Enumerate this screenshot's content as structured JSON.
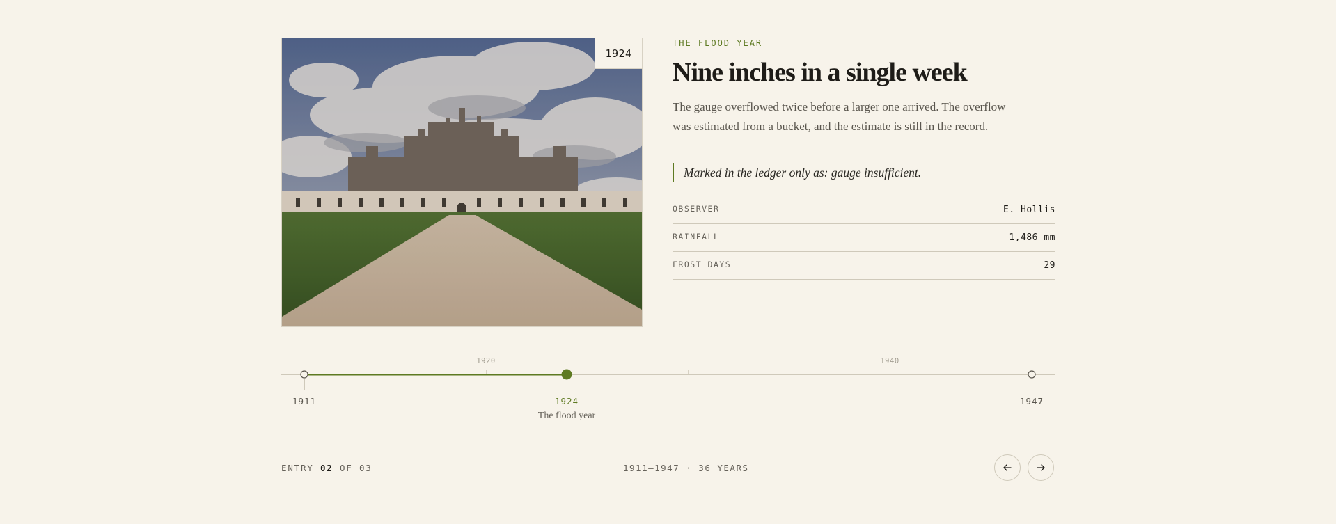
{
  "entry": {
    "year_tag": "1924",
    "kicker": "THE FLOOD YEAR",
    "title": "Nine inches in a single week",
    "description": "The gauge overflowed twice before a larger one arrived. The overflow was estimated from a bucket, and the estimate is still in the record.",
    "quote": "Marked in the ledger only as: gauge insufficient.",
    "stats": [
      {
        "label": "OBSERVER",
        "value": "E. Hollis"
      },
      {
        "label": "RAINFALL",
        "value": "1,486 mm"
      },
      {
        "label": "FROST DAYS",
        "value": "29"
      }
    ]
  },
  "timeline": {
    "tick_labels": [
      "1920",
      "1940"
    ],
    "nodes": [
      {
        "year": "1911",
        "caption": ""
      },
      {
        "year": "1924",
        "caption": "The flood year",
        "active": true
      },
      {
        "year": "1947",
        "caption": ""
      }
    ]
  },
  "footer": {
    "entry_prefix": "ENTRY",
    "entry_current": "02",
    "entry_sep": "OF",
    "entry_total": "03",
    "range": "1911–1947 · 36 YEARS",
    "prev_icon": "arrow-left-icon",
    "next_icon": "arrow-right-icon"
  },
  "colors": {
    "accent": "#5e7a22",
    "background": "#f7f3ea",
    "rule": "#cfc9ba"
  }
}
